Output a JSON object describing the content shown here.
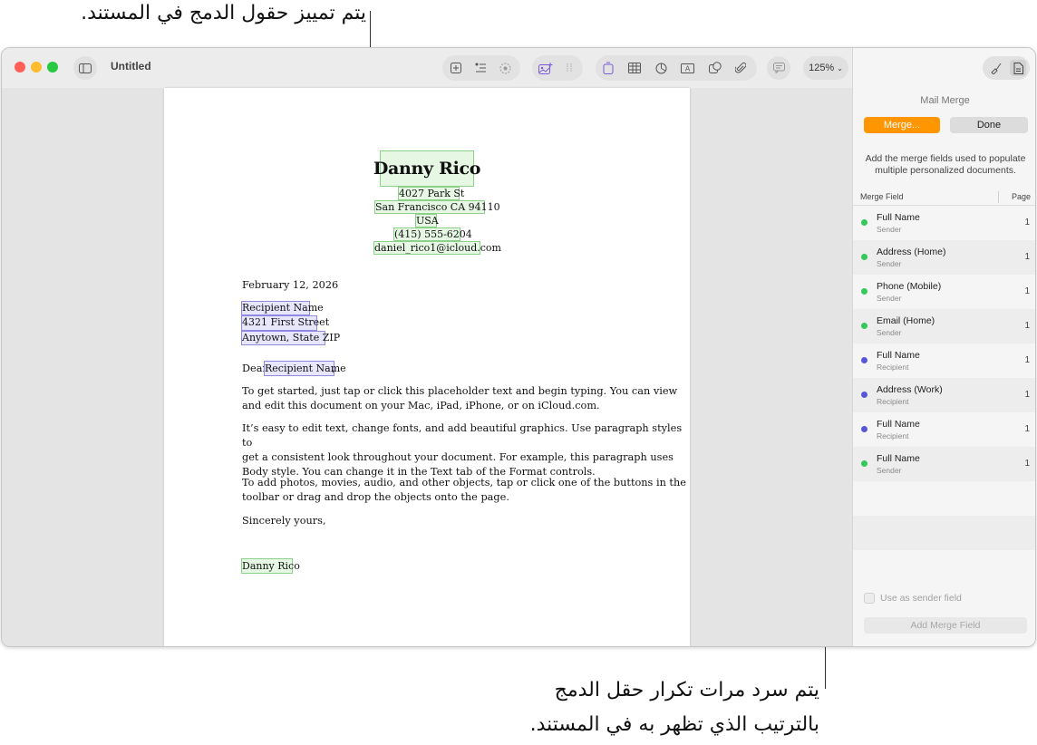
{
  "callouts": {
    "top": "يتم تمييز حقول الدمج في المستند.",
    "bottom_line1": "يتم سرد مرات تكرار حقل الدمج",
    "bottom_line2": "بالترتيب الذي تظهر به في المستند."
  },
  "window": {
    "title": "Untitled",
    "zoom": "125%",
    "traffic_lights": {
      "close": "#ff5f57",
      "minimize": "#febc2e",
      "maximize": "#28c840"
    }
  },
  "toolbar_icons": [
    "sidebar-toggle-icon",
    "add-page-icon",
    "insert-list-icon",
    "collaborate-icon",
    "media-icon",
    "grid-icon",
    "text-box-icon",
    "table-icon",
    "chart-icon",
    "shape-text-icon",
    "shape-icon",
    "attachment-icon",
    "comment-icon",
    "share-icon",
    "format-brush-icon",
    "document-icon"
  ],
  "document": {
    "sender_name": "Danny Rico",
    "sender_street": "4027 Park St",
    "sender_city": "San Francisco CA 94110",
    "sender_country": "USA",
    "sender_phone": "(415) 555-6204",
    "sender_email": "daniel_rico1@icloud.com",
    "date": "February 12, 2026",
    "recipient_name": "Recipient Name",
    "recipient_street": "4321 First Street",
    "recipient_city": "Anytown, State ZIP",
    "dear": "Dear",
    "dear_name": "Recipient Name",
    "dear_comma": ",",
    "para1_line1": "To get started, just tap or click this placeholder text and begin typing. You can view",
    "para1_line2": "and edit this document on your Mac, iPad, iPhone, or on iCloud.com.",
    "para2_line1": "It’s easy to edit text, change fonts, and add beautiful graphics. Use paragraph styles to",
    "para2_line2": "get a consistent look throughout your document. For example, this paragraph uses",
    "para2_line3": "Body style. You can change it in the Text tab of the Format controls.",
    "para3_line1": "To add photos, movies, audio, and other objects, tap or click one of the buttons in the",
    "para3_line2": "toolbar or drag and drop the objects onto the page.",
    "closing": "Sincerely yours,",
    "signature": "Danny Rico"
  },
  "sidebar": {
    "title": "Mail Merge",
    "merge_button": "Merge...",
    "done_button": "Done",
    "description": "Add the merge fields used to populate multiple personalized documents.",
    "col_field": "Merge Field",
    "col_page": "Page",
    "sender_dot_color": "#34c759",
    "recipient_dot_color": "#5856d6",
    "rows": [
      {
        "name": "Full Name",
        "sub": "Sender",
        "page": "1",
        "kind": "sender"
      },
      {
        "name": "Address (Home)",
        "sub": "Sender",
        "page": "1",
        "kind": "sender"
      },
      {
        "name": "Phone (Mobile)",
        "sub": "Sender",
        "page": "1",
        "kind": "sender"
      },
      {
        "name": "Email (Home)",
        "sub": "Sender",
        "page": "1",
        "kind": "sender"
      },
      {
        "name": "Full Name",
        "sub": "Recipient",
        "page": "1",
        "kind": "recipient"
      },
      {
        "name": "Address (Work)",
        "sub": "Recipient",
        "page": "1",
        "kind": "recipient"
      },
      {
        "name": "Full Name",
        "sub": "Recipient",
        "page": "1",
        "kind": "recipient"
      },
      {
        "name": "Full Name",
        "sub": "Sender",
        "page": "1",
        "kind": "sender"
      }
    ],
    "use_as_sender": "Use as sender field",
    "add_merge_field": "Add Merge Field"
  }
}
